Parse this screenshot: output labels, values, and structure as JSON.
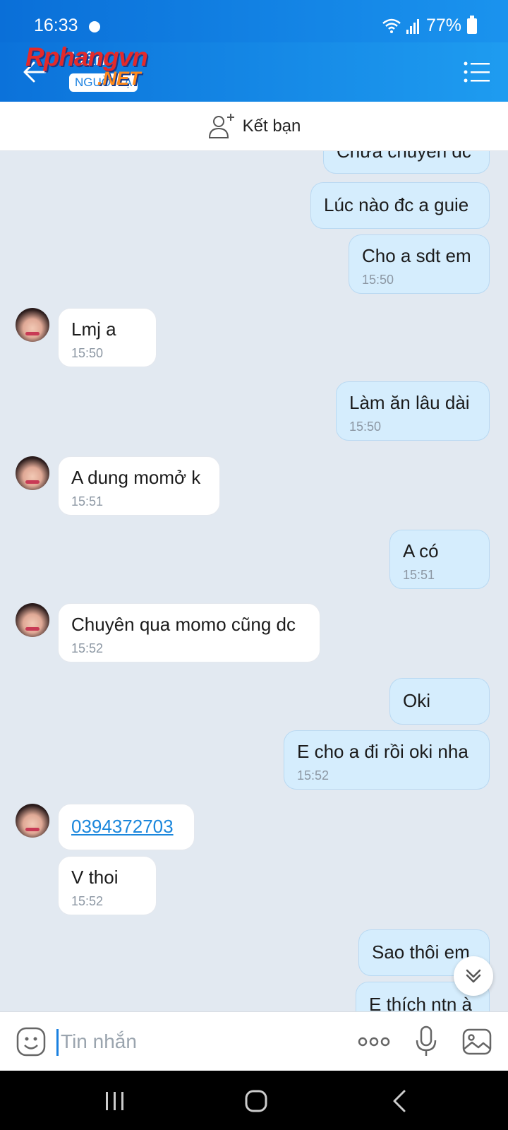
{
  "status_bar": {
    "time": "16:33",
    "battery": "77%"
  },
  "header": {
    "contact_name": "Hân",
    "status": "NGUỒI LẠ",
    "watermark": "Rphangvn",
    "watermark_suffix": ".NET"
  },
  "friend_bar": {
    "label": "Kết bạn"
  },
  "messages": [
    {
      "dir": "out",
      "text": "Chưa chuyển dc",
      "time": ""
    },
    {
      "dir": "out",
      "text": "Lúc nào đc a guie",
      "time": ""
    },
    {
      "dir": "out",
      "text": "Cho a sdt em",
      "time": "15:50"
    },
    {
      "dir": "in",
      "text": "Lmj a",
      "time": "15:50"
    },
    {
      "dir": "out",
      "text": "Làm ăn lâu dài",
      "time": "15:50"
    },
    {
      "dir": "in",
      "text": "A dung momở k",
      "time": "15:51"
    },
    {
      "dir": "out",
      "text": "A có",
      "time": "15:51"
    },
    {
      "dir": "in",
      "text": "Chuyên qua momo cũng dc",
      "time": "15:52"
    },
    {
      "dir": "out",
      "text": "Oki",
      "time": ""
    },
    {
      "dir": "out",
      "text": "E cho a đi rồi oki nha",
      "time": "15:52"
    },
    {
      "dir": "in",
      "text": "0394372703",
      "time": ""
    },
    {
      "dir": "in",
      "text": "V thoi",
      "time": "15:52"
    },
    {
      "dir": "out",
      "text": "Sao thôi em",
      "time": ""
    },
    {
      "dir": "out",
      "text": "E thích ntn à",
      "time": ""
    }
  ],
  "input": {
    "placeholder": "Tin nhắn"
  },
  "icons": {
    "back": "arrow-left-icon",
    "menu": "list-icon",
    "add_friend": "add-user-icon",
    "emoji": "emoji-icon",
    "more": "more-icon",
    "mic": "microphone-icon",
    "image": "image-icon",
    "scroll": "chevron-double-down-icon"
  },
  "colors": {
    "header": "#1a8ce8",
    "outgoing_bubble": "#d5edfd",
    "incoming_bubble": "#ffffff",
    "link": "#1b87dc"
  }
}
